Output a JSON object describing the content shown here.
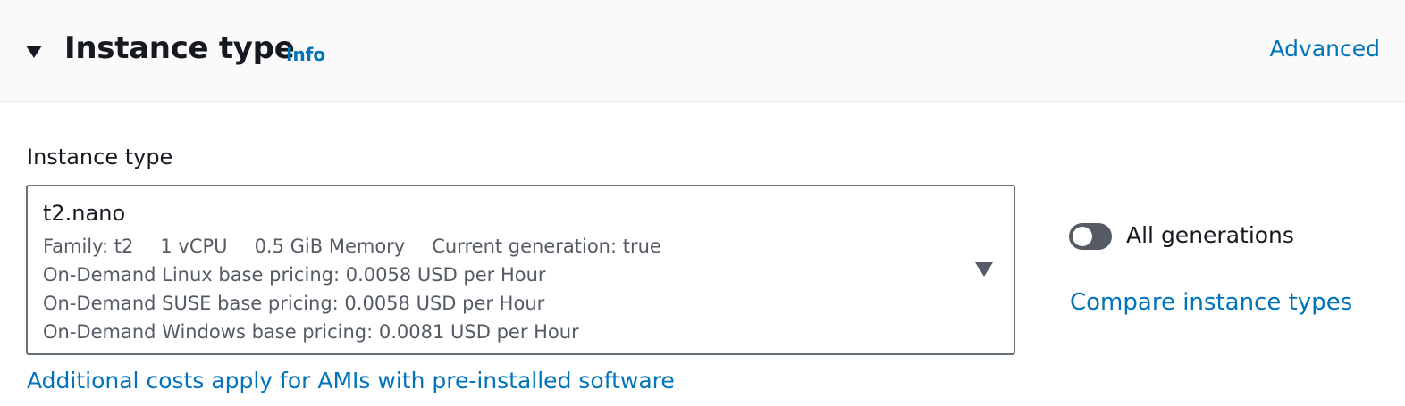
{
  "section": {
    "title": "Instance type",
    "info_label": "Info",
    "advanced_label": "Advanced",
    "expanded": true,
    "caret_icon": "caret-down-icon"
  },
  "instance_type_field": {
    "label": "Instance type",
    "selected": {
      "name": "t2.nano",
      "family": "Family: t2",
      "vcpu": "1 vCPU",
      "memory": "0.5 GiB Memory",
      "generation": "Current generation: true",
      "linux_pricing": "On-Demand Linux base pricing: 0.0058 USD per Hour",
      "suse_pricing": "On-Demand SUSE base pricing: 0.0058 USD per Hour",
      "windows_pricing": "On-Demand Windows base pricing: 0.0081 USD per Hour"
    },
    "dropdown_icon": "caret-down-icon",
    "additional_costs_link": "Additional costs apply for AMIs with pre-installed software"
  },
  "all_generations_toggle": {
    "label": "All generations",
    "enabled": false
  },
  "compare_link": "Compare instance types",
  "colors": {
    "link": "#0073bb",
    "text": "#16191f",
    "secondary_text": "#545b64",
    "header_bg": "#fafafa",
    "toggle_off": "#545b64"
  }
}
